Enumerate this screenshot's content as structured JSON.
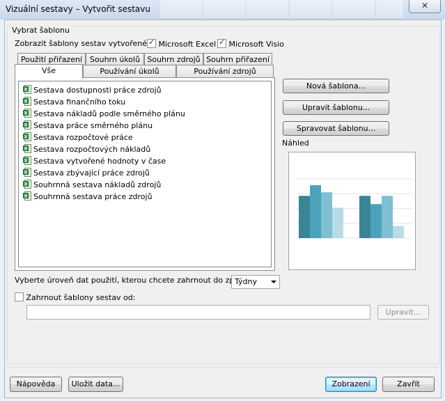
{
  "window": {
    "title": "Vizuální sestavy – Vytvořit sestavu",
    "close_glyph": "✕"
  },
  "group": {
    "label": "Vybrat šablonu",
    "show_templates_label": "Zobrazit šablony sestav vytvořené v:",
    "excel": {
      "label": "Microsoft Excel",
      "checked": true
    },
    "visio": {
      "label": "Microsoft Visio",
      "checked": true
    }
  },
  "tabs": {
    "row_back": [
      "Použití přiřazení",
      "Souhrn úkolů",
      "Souhrn zdrojů",
      "Souhrn přiřazení"
    ],
    "row_front": [
      "Vše",
      "Používání úkolů",
      "Používání zdrojů"
    ],
    "active": "Vše"
  },
  "templates": [
    "Sestava dostupnosti práce zdrojů",
    "Sestava finančního toku",
    "Sestava nákladů podle směrného plánu",
    "Sestava práce směrného plánu",
    "Sestava rozpočtové práce",
    "Sestava rozpočtových nákladů",
    "Sestava vytvořené hodnoty v čase",
    "Sestava zbývající práce zdrojů",
    "Souhrnná sestava nákladů zdrojů",
    "Souhrnná sestava práce zdrojů"
  ],
  "side_buttons": {
    "new": "Nová šablona...",
    "edit": "Upravit šablonu...",
    "manage": "Spravovat šablonu..."
  },
  "preview": {
    "label": "Náhled",
    "colors": [
      "#3b8496",
      "#4aa3bb",
      "#7fbfd1",
      "#b8dbe7"
    ],
    "group1": [
      0.62,
      0.8,
      0.68,
      0.42
    ],
    "group2": [
      0.62,
      0.48,
      0.62,
      0.11
    ]
  },
  "usage": {
    "label": "Vyberte úroveň dat použití, kterou chcete zahrnout do zprávy:",
    "selected": "Týdny"
  },
  "include": {
    "label": "Zahrnout šablony sestav od:",
    "checked": false,
    "path_value": "",
    "modify_button": "Upravit..."
  },
  "footer": {
    "help": "Nápověda",
    "save_data": "Uložit data...",
    "view": "Zobrazení",
    "close": "Zavřít"
  }
}
